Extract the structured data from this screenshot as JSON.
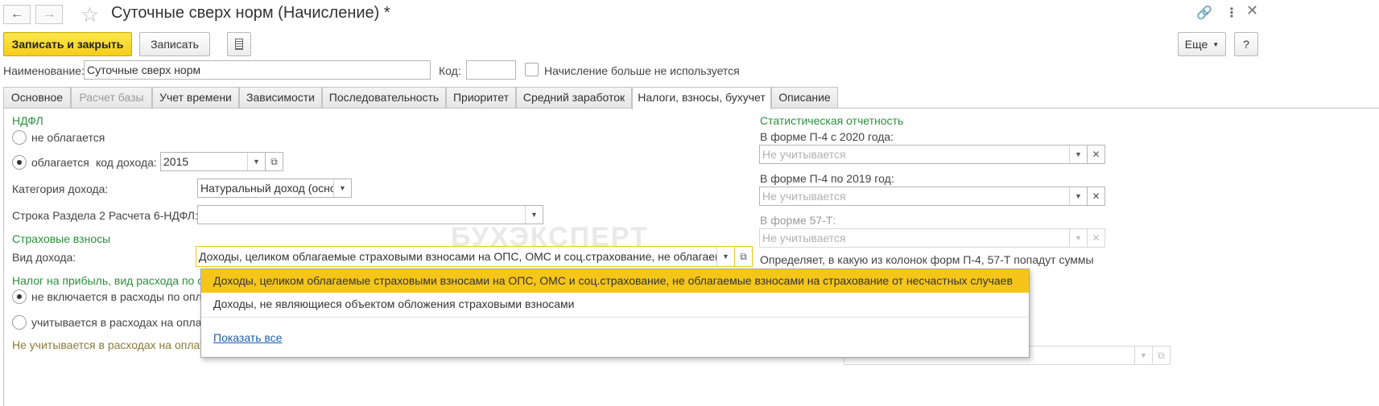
{
  "window": {
    "title": "Суточные сверх норм (Начисление) *"
  },
  "toolbar": {
    "save_close": "Записать и закрыть",
    "save": "Записать",
    "more": "Еще",
    "help": "?"
  },
  "header": {
    "name_label": "Наименование:",
    "name_value": "Суточные сверх норм",
    "code_label": "Код:",
    "code_value": "",
    "unused_label": "Начисление больше не используется"
  },
  "tabs": [
    {
      "label": "Основное"
    },
    {
      "label": "Расчет базы"
    },
    {
      "label": "Учет времени"
    },
    {
      "label": "Зависимости"
    },
    {
      "label": "Последовательность"
    },
    {
      "label": "Приоритет"
    },
    {
      "label": "Средний заработок"
    },
    {
      "label": "Налоги, взносы, бухучет"
    },
    {
      "label": "Описание"
    }
  ],
  "ndfl": {
    "section": "НДФЛ",
    "not_taxed": "не облагается",
    "taxed": "облагается",
    "code_label": "код дохода:",
    "code_value": "2015",
    "category_label": "Категория дохода:",
    "category_value": "Натуральный доход (осно",
    "line_label": "Строка Раздела 2 Расчета 6-НДФЛ:",
    "line_value": ""
  },
  "insurance": {
    "section": "Страховые взносы",
    "kind_label": "Вид дохода:",
    "kind_value": "Доходы, целиком облагаемые страховыми взносами на ОПС, ОМС и соц.страхование, не облагаемые"
  },
  "profit": {
    "section": "Налог на прибыль, вид расхода по ст",
    "opt1": "не включается в расходы по опл",
    "opt2": "учитывается в расходах на оплат",
    "note": "Не учитывается в расходах на оплат"
  },
  "stats": {
    "section": "Статистическая отчетность",
    "p4_2020_label": "В форме П-4 с 2020 года:",
    "p4_2020_placeholder": "Не учитывается",
    "p4_2019_label": "В форме П-4 по 2019 год:",
    "p4_2019_placeholder": "Не учитывается",
    "f57_label": "В форме 57-Т:",
    "f57_placeholder": "Не учитывается",
    "note": "Определяет, в какую из колонок форм П-4, 57-Т попадут суммы"
  },
  "popup": {
    "options": [
      "Доходы, целиком облагаемые страховыми взносами на ОПС, ОМС и соц.страхование, не облагаемые взносами на страхование от несчастных случаев",
      "Доходы, не являющиеся объектом обложения страховыми взносами"
    ],
    "show_all": "Показать все"
  },
  "watermark": "БУХЭКСПЕРТ",
  "colors": {
    "accent_yellow": "#f5c51a",
    "section_green": "#2b8f3b",
    "link_blue": "#1b5fb0"
  }
}
